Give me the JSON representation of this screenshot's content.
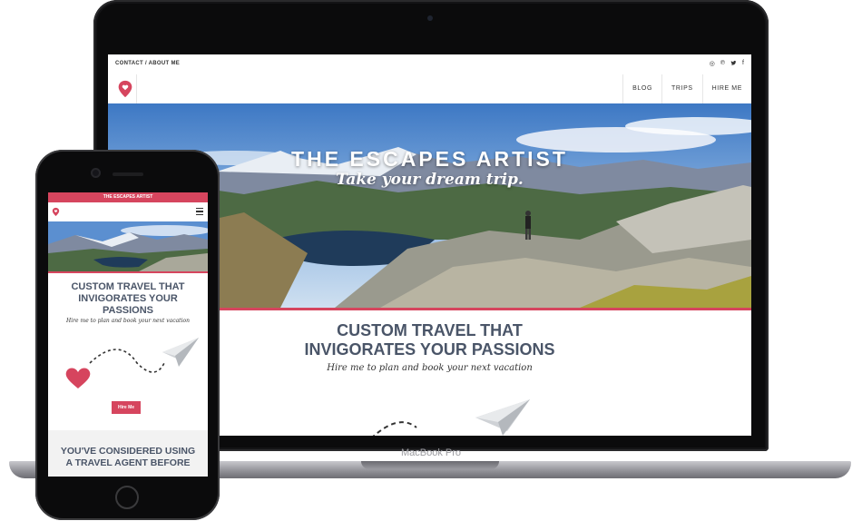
{
  "laptop": {
    "brand": "MacBook Pro",
    "site": {
      "top_links": "CONTACT / ABOUT ME",
      "social": [
        "instagram-icon",
        "pinterest-icon",
        "twitter-icon",
        "facebook-icon"
      ],
      "social_glyphs": [
        "◎",
        "℗",
        "🐦",
        "f"
      ],
      "nav": [
        "BLOG",
        "TRIPS",
        "HIRE ME"
      ],
      "hero": {
        "title": "THE ESCAPES ARTIST",
        "subtitle": "Take your dream trip."
      },
      "heading": [
        "CUSTOM TRAVEL THAT",
        "INVIGORATES YOUR PASSIONS"
      ],
      "tagline": "Hire me to plan and book your next vacation"
    }
  },
  "phone": {
    "site": {
      "banner": "THE ESCAPES ARTIST",
      "heading": [
        "CUSTOM TRAVEL THAT",
        "INVIGORATES YOUR",
        "PASSIONS"
      ],
      "tagline": "Hire me to plan and book your next vacation",
      "button": "Hire Me",
      "section_title": [
        "YOU'VE CONSIDERED USING",
        "A TRAVEL AGENT BEFORE"
      ]
    }
  },
  "colors": {
    "accent": "#d6455e",
    "heading": "#4a5568"
  }
}
